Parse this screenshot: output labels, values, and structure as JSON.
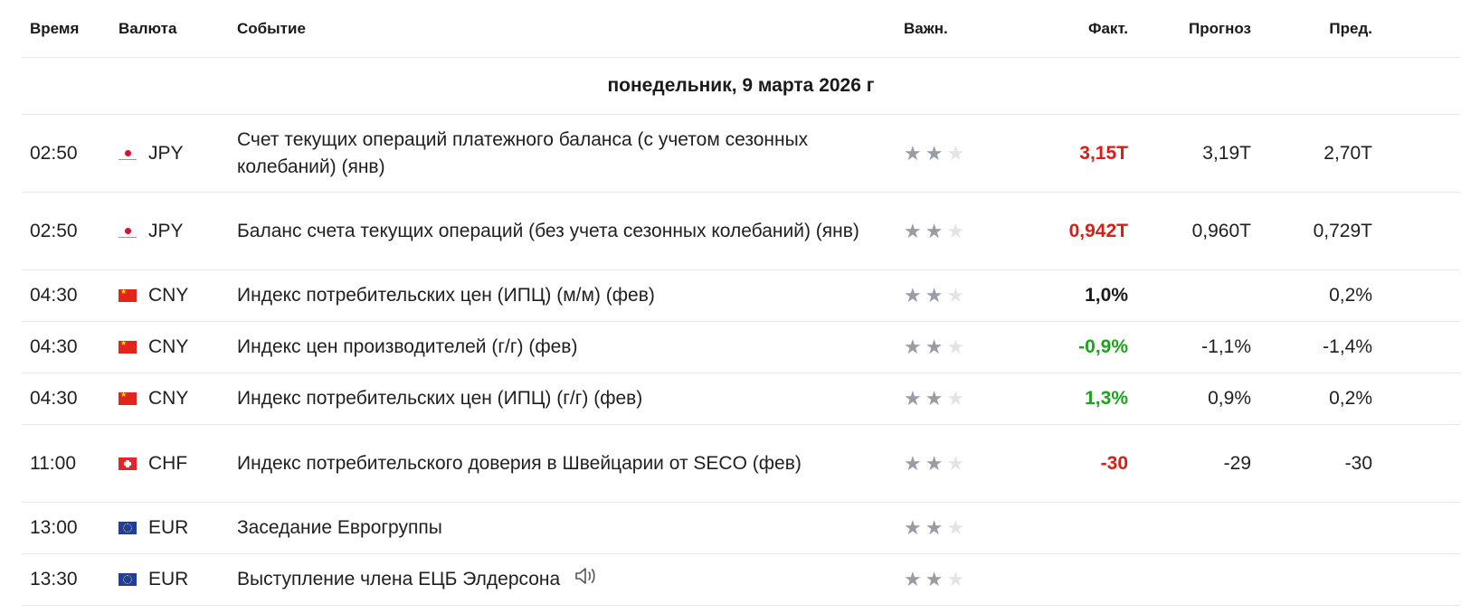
{
  "header": {
    "time": "Время",
    "currency": "Валюта",
    "event": "Событие",
    "importance": "Важн.",
    "actual": "Факт.",
    "forecast": "Прогноз",
    "previous": "Пред."
  },
  "date_label": "понедельник, 9 марта 2026 г",
  "colors": {
    "negative": "#d91e18",
    "positive": "#1ea11e",
    "star_on": "#9a9ca3",
    "star_off": "#e3e4e8"
  },
  "rows": [
    {
      "time": "02:50",
      "currency": "JPY",
      "flag": "japan-flag-icon",
      "event": "Счет текущих операций платежного баланса (с учетом сезонных колебаний) (янв)",
      "importance": 2,
      "actual": "3,15T",
      "actual_status": "negative",
      "forecast": "3,19T",
      "previous": "2,70T"
    },
    {
      "time": "02:50",
      "currency": "JPY",
      "flag": "japan-flag-icon",
      "event": "Баланс счета текущих операций (без учета сезонных колебаний) (янв)",
      "importance": 2,
      "actual": "0,942T",
      "actual_status": "negative",
      "forecast": "0,960T",
      "previous": "0,729T"
    },
    {
      "time": "04:30",
      "currency": "CNY",
      "flag": "china-flag-icon",
      "event": "Индекс потребительских цен (ИПЦ) (м/м) (фев)",
      "importance": 2,
      "actual": "1,0%",
      "actual_status": "neutral",
      "forecast": "",
      "previous": "0,2%"
    },
    {
      "time": "04:30",
      "currency": "CNY",
      "flag": "china-flag-icon",
      "event": "Индекс цен производителей (г/г) (фев)",
      "importance": 2,
      "actual": "-0,9%",
      "actual_status": "positive",
      "forecast": "-1,1%",
      "previous": "-1,4%"
    },
    {
      "time": "04:30",
      "currency": "CNY",
      "flag": "china-flag-icon",
      "event": "Индекс потребительских цен (ИПЦ) (г/г) (фев)",
      "importance": 2,
      "actual": "1,3%",
      "actual_status": "positive",
      "forecast": "0,9%",
      "previous": "0,2%"
    },
    {
      "time": "11:00",
      "currency": "CHF",
      "flag": "switzerland-flag-icon",
      "event": "Индекс потребительского доверия в Швейцарии от SECO (фев)",
      "importance": 2,
      "actual": "-30",
      "actual_status": "negative",
      "forecast": "-29",
      "previous": "-30"
    },
    {
      "time": "13:00",
      "currency": "EUR",
      "flag": "eu-flag-icon",
      "event": "Заседание Еврогруппы",
      "importance": 2,
      "actual": "",
      "actual_status": "neutral",
      "forecast": "",
      "previous": ""
    },
    {
      "time": "13:30",
      "currency": "EUR",
      "flag": "eu-flag-icon",
      "event": "Выступление члена ЕЦБ Элдерсона",
      "importance": 2,
      "actual": "",
      "actual_status": "neutral",
      "forecast": "",
      "previous": "",
      "speech_icon": "speaker-icon"
    }
  ]
}
